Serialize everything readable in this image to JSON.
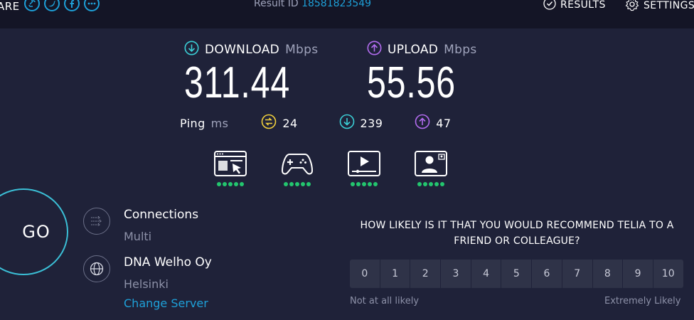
{
  "header": {
    "share_label": "ARE",
    "result_id_label": "Result ID",
    "result_id": "18581823549",
    "results_label": "RESULTS",
    "settings_label": "SETTINGS"
  },
  "download": {
    "label": "DOWNLOAD",
    "unit": "Mbps",
    "value": "311.44"
  },
  "upload": {
    "label": "UPLOAD",
    "unit": "Mbps",
    "value": "55.56"
  },
  "ping": {
    "label": "Ping",
    "unit": "ms",
    "idle": "24",
    "download": "239",
    "upload": "47"
  },
  "apps": [
    {
      "name": "web-browsing-icon",
      "rating": 5
    },
    {
      "name": "gaming-icon",
      "rating": 5
    },
    {
      "name": "video-streaming-icon",
      "rating": 5
    },
    {
      "name": "video-chat-icon",
      "rating": 5
    }
  ],
  "go_label": "GO",
  "connections": {
    "title": "Connections",
    "value": "Multi"
  },
  "server": {
    "title": "DNA Welho Oy",
    "location": "Helsinki",
    "change_label": "Change Server"
  },
  "survey": {
    "question": "HOW LIKELY IS IT THAT YOU WOULD RECOMMEND TELIA TO A FRIEND OR COLLEAGUE?",
    "options": [
      "0",
      "1",
      "2",
      "3",
      "4",
      "5",
      "6",
      "7",
      "8",
      "9",
      "10"
    ],
    "low_label": "Not at all likely",
    "high_label": "Extremely Likely"
  },
  "colors": {
    "background": "#1f2239",
    "topbar": "#141526",
    "accent_blue": "#1ea0d8",
    "download_teal": "#3bcfd6",
    "upload_purple": "#b36cf0",
    "ping_yellow": "#f2d13c",
    "rating_green": "#23c66e"
  }
}
